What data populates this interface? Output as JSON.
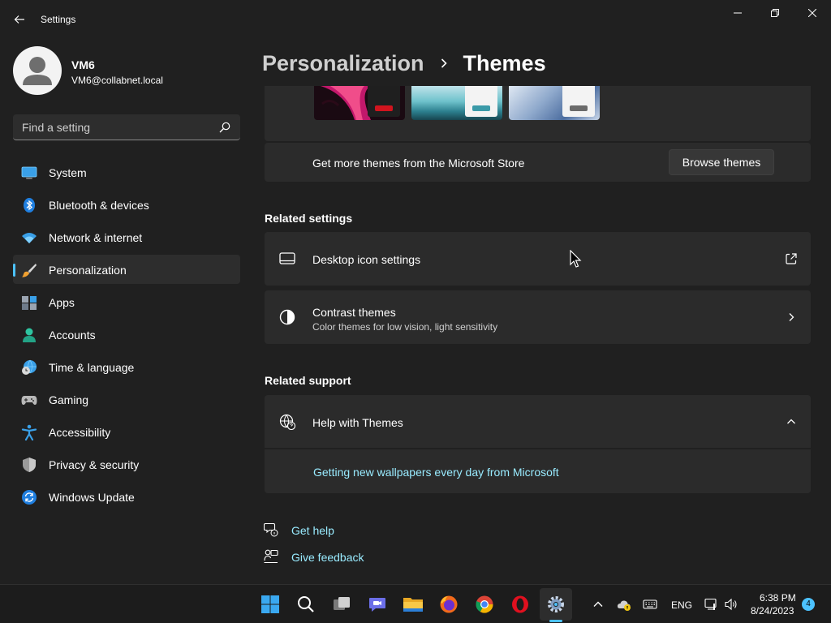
{
  "window": {
    "title": "Settings"
  },
  "profile": {
    "name": "VM6",
    "email": "VM6@collabnet.local"
  },
  "search": {
    "placeholder": "Find a setting",
    "value": ""
  },
  "sidebar": {
    "items": [
      {
        "label": "System",
        "icon": "monitor-icon",
        "active": false
      },
      {
        "label": "Bluetooth & devices",
        "icon": "bluetooth-icon",
        "active": false
      },
      {
        "label": "Network & internet",
        "icon": "wifi-icon",
        "active": false
      },
      {
        "label": "Personalization",
        "icon": "paintbrush-icon",
        "active": true
      },
      {
        "label": "Apps",
        "icon": "apps-icon",
        "active": false
      },
      {
        "label": "Accounts",
        "icon": "person-icon",
        "active": false
      },
      {
        "label": "Time & language",
        "icon": "globe-clock-icon",
        "active": false
      },
      {
        "label": "Gaming",
        "icon": "gamepad-icon",
        "active": false
      },
      {
        "label": "Accessibility",
        "icon": "accessibility-icon",
        "active": false
      },
      {
        "label": "Privacy & security",
        "icon": "shield-icon",
        "active": false
      },
      {
        "label": "Windows Update",
        "icon": "update-icon",
        "active": false
      }
    ]
  },
  "breadcrumb": {
    "parent": "Personalization",
    "current": "Themes"
  },
  "themes": {
    "store_text": "Get more themes from the Microsoft Store",
    "browse_button": "Browse themes"
  },
  "related_settings": {
    "title": "Related settings",
    "items": [
      {
        "label": "Desktop icon settings",
        "icon": "desktop-icon",
        "trail": "external-link-icon"
      },
      {
        "label": "Contrast themes",
        "sub": "Color themes for low vision, light sensitivity",
        "icon": "contrast-icon",
        "trail": "chevron-right-icon"
      }
    ]
  },
  "related_support": {
    "title": "Related support",
    "help_label": "Help with Themes",
    "help_link": "Getting new wallpapers every day from Microsoft"
  },
  "footer": {
    "get_help": "Get help",
    "give_feedback": "Give feedback"
  },
  "taskbar": {
    "language": "ENG",
    "time": "6:38 PM",
    "date": "8/24/2023",
    "notification_count": "4"
  },
  "colors": {
    "accent": "#4cc2ff",
    "link": "#99ebff",
    "background": "#202020",
    "card": "#2b2b2b"
  }
}
